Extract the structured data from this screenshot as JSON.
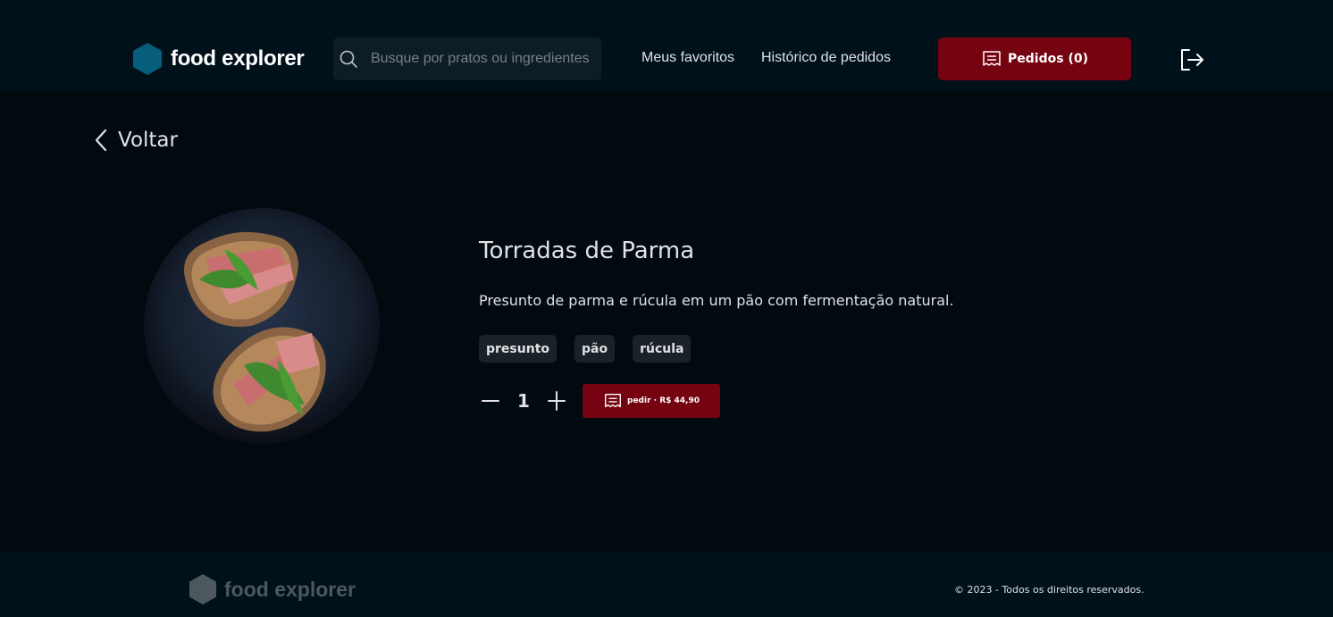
{
  "header": {
    "brand": "food explorer",
    "search_placeholder": "Busque por pratos ou ingredientes",
    "nav": {
      "favorites": "Meus favoritos",
      "history": "Histórico de pedidos"
    },
    "orders_label": "Pedidos (0)"
  },
  "back_label": "Voltar",
  "dish": {
    "title": "Torradas de Parma",
    "description": "Presunto de parma e rúcula em um pão com fermentação natural.",
    "ingredients": [
      "presunto",
      "pão",
      "rúcula"
    ],
    "quantity": "1",
    "order_label": "pedir ∙ R$ 44,90"
  },
  "footer": {
    "brand": "food explorer",
    "copyright": "© 2023 - Todos os direitos reservados."
  },
  "colors": {
    "background": "#000A0F",
    "header_bg": "#00111A",
    "accent_red": "#750310",
    "brand_blue": "#065E7C",
    "tag_bg": "#192227"
  },
  "icons": [
    "hexagon-logo-icon",
    "search-icon",
    "receipt-icon",
    "sign-out-icon",
    "chevron-left-icon",
    "minus-icon",
    "plus-icon"
  ]
}
